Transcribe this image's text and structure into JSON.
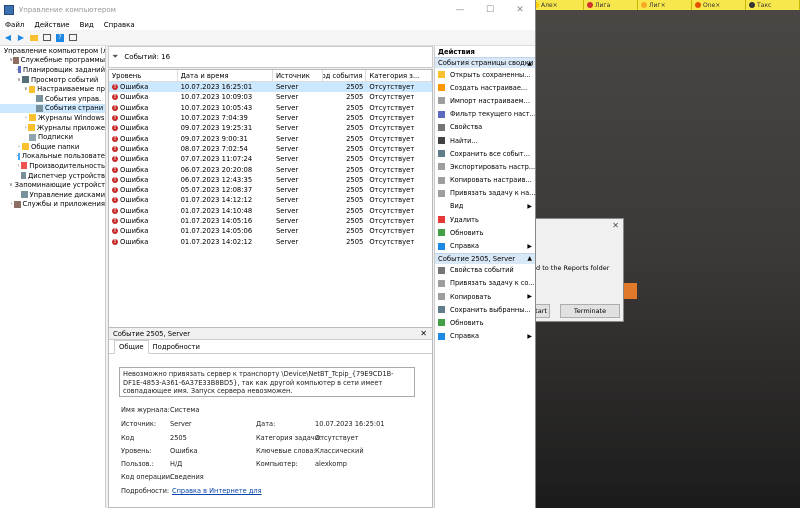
{
  "browser_tabs": [
    {
      "label": "Але×",
      "color": "#ffcc00"
    },
    {
      "label": "Лига",
      "color": "#d32f2f"
    },
    {
      "label": "Лиг×",
      "color": "#f9a825"
    },
    {
      "label": "One×",
      "color": "#e65100"
    },
    {
      "label": "Такс",
      "color": "#333333"
    }
  ],
  "window": {
    "title": "Управление компьютером",
    "minimize": "—",
    "maximize": "☐",
    "close": "✕"
  },
  "menu": [
    "Файл",
    "Действие",
    "Вид",
    "Справка"
  ],
  "tree": [
    {
      "label": "Управление компьютером (л",
      "indent": 0,
      "exp": "",
      "icon": "computer-icon",
      "color": "#607d8b"
    },
    {
      "label": "Служебные программы",
      "indent": 1,
      "exp": "∨",
      "icon": "tools-icon",
      "color": "#8d6e63"
    },
    {
      "label": "Планировщик заданий",
      "indent": 2,
      "exp": "›",
      "icon": "clock-icon",
      "color": "#5c6bc0"
    },
    {
      "label": "Просмотр событий",
      "indent": 2,
      "exp": "∨",
      "icon": "event-viewer-icon",
      "color": "#546e7a"
    },
    {
      "label": "Настраиваемые пр",
      "indent": 3,
      "exp": "∨",
      "icon": "folder-icon",
      "color": "#fbc02d"
    },
    {
      "label": "События управ.",
      "indent": 4,
      "exp": "",
      "icon": "filter-icon",
      "color": "#78909c"
    },
    {
      "label": "События страни",
      "indent": 4,
      "exp": "",
      "icon": "filter-icon",
      "color": "#78909c",
      "selected": true
    },
    {
      "label": "Журналы Windows",
      "indent": 3,
      "exp": "›",
      "icon": "folder-icon",
      "color": "#fbc02d"
    },
    {
      "label": "Журналы приложе",
      "indent": 3,
      "exp": "›",
      "icon": "folder-icon",
      "color": "#fbc02d"
    },
    {
      "label": "Подписки",
      "indent": 3,
      "exp": "",
      "icon": "subscription-icon",
      "color": "#90a4ae"
    },
    {
      "label": "Общие папки",
      "indent": 2,
      "exp": "›",
      "icon": "shared-folder-icon",
      "color": "#fbc02d"
    },
    {
      "label": "Локальные пользовате",
      "indent": 2,
      "exp": "›",
      "icon": "users-icon",
      "color": "#42a5f5"
    },
    {
      "label": "Производительность",
      "indent": 2,
      "exp": "›",
      "icon": "performance-icon",
      "color": "#ef5350"
    },
    {
      "label": "Диспетчер устройств",
      "indent": 2,
      "exp": "",
      "icon": "device-manager-icon",
      "color": "#78909c"
    },
    {
      "label": "Запоминающие устройст",
      "indent": 1,
      "exp": "∨",
      "icon": "storage-icon",
      "color": "#8d6e63"
    },
    {
      "label": "Управление дисками",
      "indent": 2,
      "exp": "",
      "icon": "disk-icon",
      "color": "#78909c"
    },
    {
      "label": "Службы и приложения",
      "indent": 1,
      "exp": "›",
      "icon": "services-icon",
      "color": "#8d6e63"
    }
  ],
  "events_header": {
    "label": "Событий: 16"
  },
  "table": {
    "columns": [
      "Уровень",
      "Дата и время",
      "Источник",
      "Код события",
      "Категория з..."
    ],
    "rows": [
      [
        "Ошибка",
        "10.07.2023 16:25:01",
        "Server",
        "2505",
        "Отсутствует"
      ],
      [
        "Ошибка",
        "10.07.2023 10:09:03",
        "Server",
        "2505",
        "Отсутствует"
      ],
      [
        "Ошибка",
        "10.07.2023 10:05:43",
        "Server",
        "2505",
        "Отсутствует"
      ],
      [
        "Ошибка",
        "10.07.2023 7:04:39",
        "Server",
        "2505",
        "Отсутствует"
      ],
      [
        "Ошибка",
        "09.07.2023 19:25:31",
        "Server",
        "2505",
        "Отсутствует"
      ],
      [
        "Ошибка",
        "09.07.2023 9:00:31",
        "Server",
        "2505",
        "Отсутствует"
      ],
      [
        "Ошибка",
        "08.07.2023 7:02:54",
        "Server",
        "2505",
        "Отсутствует"
      ],
      [
        "Ошибка",
        "07.07.2023 11:07:24",
        "Server",
        "2505",
        "Отсутствует"
      ],
      [
        "Ошибка",
        "06.07.2023 20:20:08",
        "Server",
        "2505",
        "Отсутствует"
      ],
      [
        "Ошибка",
        "06.07.2023 12:43:35",
        "Server",
        "2505",
        "Отсутствует"
      ],
      [
        "Ошибка",
        "05.07.2023 12:08:37",
        "Server",
        "2505",
        "Отсутствует"
      ],
      [
        "Ошибка",
        "01.07.2023 14:12:12",
        "Server",
        "2505",
        "Отсутствует"
      ],
      [
        "Ошибка",
        "01.07.2023 14:10:48",
        "Server",
        "2505",
        "Отсутствует"
      ],
      [
        "Ошибка",
        "01.07.2023 14:05:16",
        "Server",
        "2505",
        "Отсутствует"
      ],
      [
        "Ошибка",
        "01.07.2023 14:05:06",
        "Server",
        "2505",
        "Отсутствует"
      ],
      [
        "Ошибка",
        "01.07.2023 14:02:12",
        "Server",
        "2505",
        "Отсутствует"
      ]
    ]
  },
  "detail": {
    "title": "Событие 2505, Server",
    "close": "✕",
    "tab_general": "Общие",
    "tab_details": "Подробности",
    "message": "Невозможно привязать сервер к транспорту \\Device\\NetBT_Tcpip_{79E9CD1B-DF1E-4853-A361-6A37E33B8BD5}, так как другой компьютер в сети имеет совпадающее имя.  Запуск сервера невозможен.",
    "fields": {
      "log_label": "Имя журнала:",
      "log_value": "Система",
      "source_label": "Источник:",
      "source_value": "Server",
      "date_label": "Дата:",
      "date_value": "10.07.2023 16:25:01",
      "code_label": "Код",
      "code_value": "2505",
      "category_label": "Категория задачи:",
      "category_value": "Отсутствует",
      "level_label": "Уровень:",
      "level_value": "Ошибка",
      "keywords_label": "Ключевые слова:",
      "keywords_value": "Классический",
      "user_label": "Пользов.:",
      "user_value": "Н/Д",
      "computer_label": "Компьютер:",
      "computer_value": "alexkomp",
      "opcode_label": "Код операции:",
      "opcode_value": "Сведения",
      "more_label": "Подробности:",
      "more_link": "Справка в Интернете для"
    }
  },
  "actions": {
    "header": "Действия",
    "section1": "События страницы сводки",
    "items1": [
      {
        "label": "Открыть сохраненны...",
        "icon": "open-folder-icon",
        "color": "#fbc02d"
      },
      {
        "label": "Создать настраивае...",
        "icon": "create-filter-icon",
        "color": "#ff9800"
      },
      {
        "label": "Импорт настраивaeм...",
        "icon": "import-icon",
        "color": "#9e9e9e"
      },
      {
        "label": "Фильтр текущего наст...",
        "icon": "filter-icon",
        "color": "#5c6bc0"
      },
      {
        "label": "Свойства",
        "icon": "properties-icon",
        "color": "#757575"
      },
      {
        "label": "Найти...",
        "icon": "find-icon",
        "color": "#424242"
      },
      {
        "label": "Сохранить все событ...",
        "icon": "save-icon",
        "color": "#607d8b"
      },
      {
        "label": "Экспортировать настр...",
        "icon": "export-icon",
        "color": "#9e9e9e"
      },
      {
        "label": "Копировать настраив...",
        "icon": "copy-icon",
        "color": "#9e9e9e"
      },
      {
        "label": "Привязать задачу к на...",
        "icon": "attach-task-icon",
        "color": "#9e9e9e"
      },
      {
        "label": "Вид",
        "icon": "blank-icon",
        "color": "transparent",
        "arrow": true
      },
      {
        "label": "Удалить",
        "icon": "delete-icon",
        "color": "#e53935"
      },
      {
        "label": "Обновить",
        "icon": "refresh-icon",
        "color": "#43a047"
      },
      {
        "label": "Справка",
        "icon": "help-icon",
        "color": "#1e88e5",
        "arrow": true
      }
    ],
    "section2": "Событие 2505, Server",
    "items2": [
      {
        "label": "Свойства событий",
        "icon": "event-properties-icon",
        "color": "#757575"
      },
      {
        "label": "Привязать задачу к со...",
        "icon": "attach-task-icon",
        "color": "#9e9e9e"
      },
      {
        "label": "Копировать",
        "icon": "copy-icon",
        "color": "#9e9e9e",
        "arrow": true
      },
      {
        "label": "Сохранить выбранны...",
        "icon": "save-icon",
        "color": "#607d8b"
      },
      {
        "label": "Обновить",
        "icon": "refresh-icon",
        "color": "#43a047"
      },
      {
        "label": "Справка",
        "icon": "help-icon",
        "color": "#1e88e5",
        "arrow": true
      }
    ],
    "arrow": "▶",
    "collapse": "▲"
  },
  "background_dialog": {
    "text": "d to the Reports folder",
    "close": "✕",
    "start": "Start",
    "terminate": "Terminate"
  }
}
